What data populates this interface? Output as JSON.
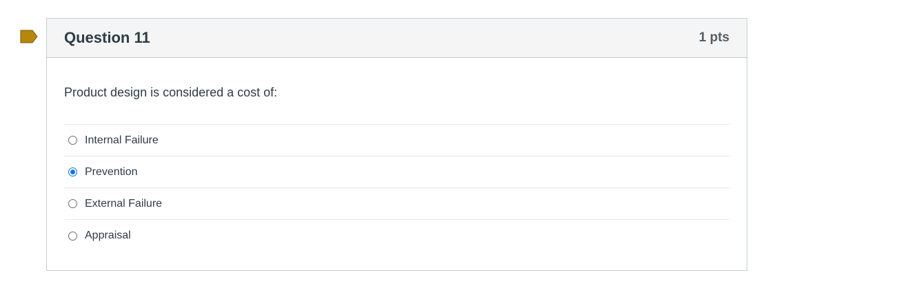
{
  "question": {
    "title": "Question 11",
    "points": "1 pts",
    "text": "Product design is considered a cost of:",
    "flag_icon": "bookmark-flag-icon",
    "flag_color": "#b8860b",
    "answers": [
      {
        "label": "Internal Failure",
        "selected": false
      },
      {
        "label": "Prevention",
        "selected": true
      },
      {
        "label": "External Failure",
        "selected": false
      },
      {
        "label": "Appraisal",
        "selected": false
      }
    ],
    "selected_color": "#0b72e7"
  }
}
